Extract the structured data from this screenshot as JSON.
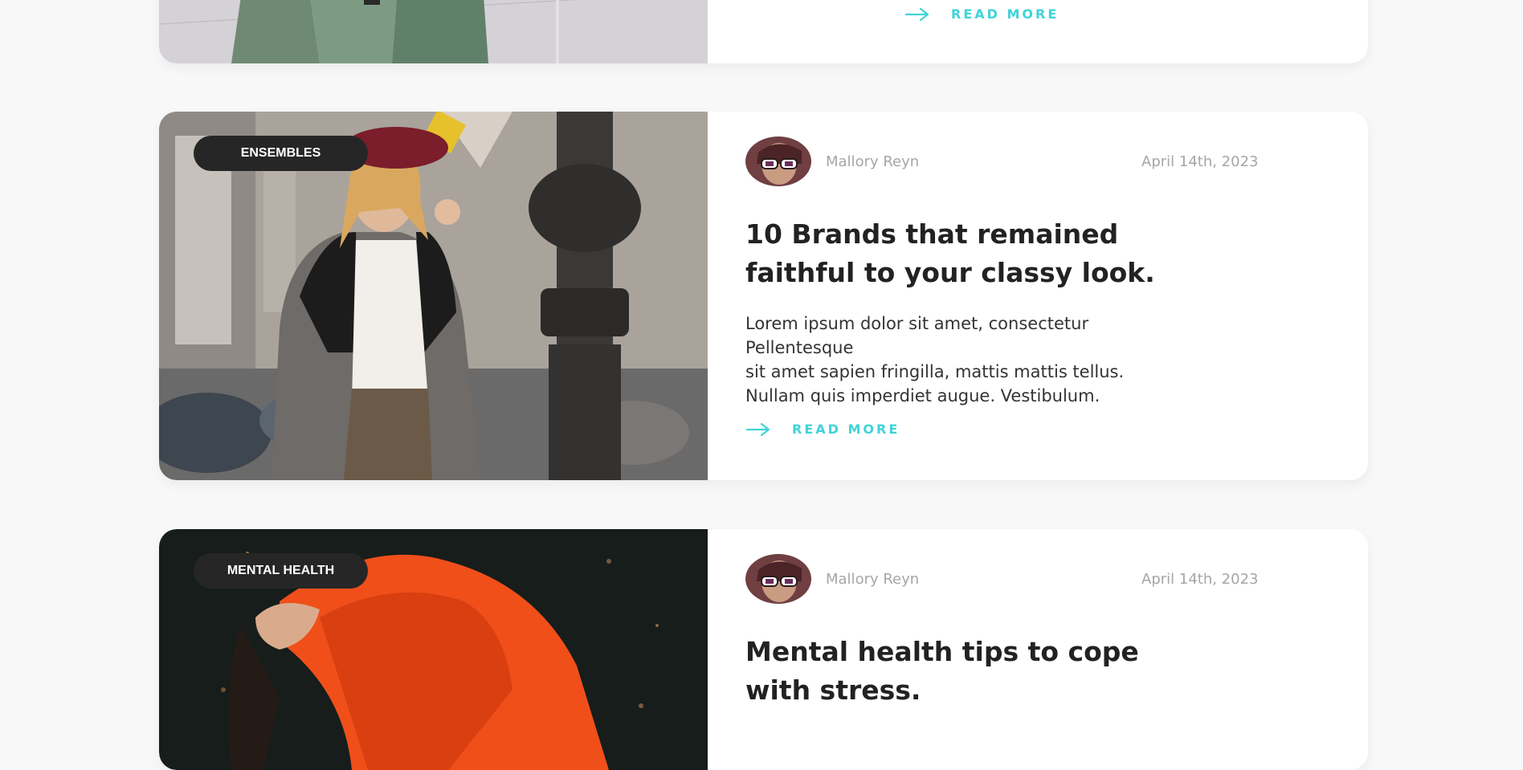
{
  "colors": {
    "accent": "#3fd3d9",
    "tag_bg": "#262626",
    "muted": "#a6a6a6",
    "heading": "#222222"
  },
  "posts": [
    {
      "read_more": "READ MORE"
    },
    {
      "tag": "ENSEMBLES",
      "author": "Mallory Reyn",
      "date": "April 14th, 2023",
      "title_line1": "10 Brands that remained",
      "title_line2": "faithful to your classy look.",
      "excerpt_line1": "Lorem ipsum dolor sit amet, consectetur Pellentesque",
      "excerpt_line2": "sit amet sapien fringilla, mattis mattis tellus.",
      "excerpt_line3": "Nullam quis imperdiet augue. Vestibulum.",
      "read_more": "READ MORE"
    },
    {
      "tag": "MENTAL HEALTH",
      "author": "Mallory Reyn",
      "date": "April 14th, 2023",
      "title_line1": "Mental health tips to cope",
      "title_line2": "with stress."
    }
  ]
}
